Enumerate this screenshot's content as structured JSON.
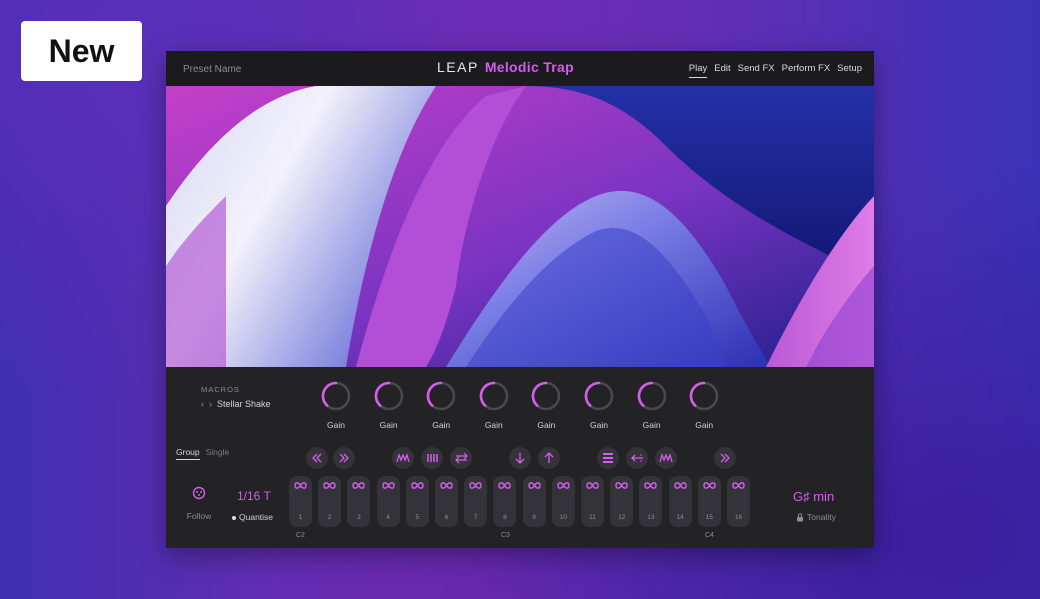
{
  "badge": {
    "label": "New"
  },
  "header": {
    "preset_name": "Preset Name",
    "logo_brand": "LEAP",
    "logo_product": "Melodic Trap",
    "nav": [
      "Play",
      "Edit",
      "Send FX",
      "Perform FX",
      "Setup"
    ],
    "active_tab": "Play"
  },
  "macros": {
    "section_label": "MACROS",
    "prev_icon": "chevron-left-icon",
    "next_icon": "chevron-right-icon",
    "current": "Stellar Shake",
    "knobs": [
      {
        "label": "Gain"
      },
      {
        "label": "Gain"
      },
      {
        "label": "Gain"
      },
      {
        "label": "Gain"
      },
      {
        "label": "Gain"
      },
      {
        "label": "Gain"
      },
      {
        "label": "Gain"
      },
      {
        "label": "Gain"
      }
    ]
  },
  "modes": {
    "group": "Group",
    "single": "Single"
  },
  "transport_icons": [
    "rewind-icon",
    "fast-forward-icon",
    "wave-icon",
    "bars-icon",
    "swap-icon",
    "arrow-down-icon",
    "arrow-up-icon",
    "list-icon",
    "arrow-back-icon",
    "wave-icon",
    "skip-icon"
  ],
  "follow": {
    "label": "Follow",
    "icon": "follow-icon"
  },
  "rate": {
    "value": "1/16 T",
    "quantise_label": "Quantise"
  },
  "pads": {
    "numbers": [
      "1",
      "2",
      "3",
      "4",
      "5",
      "6",
      "7",
      "8",
      "9",
      "10",
      "11",
      "12",
      "13",
      "14",
      "15",
      "16"
    ],
    "icon": "infinity-icon",
    "octaves": [
      "C2",
      "C3",
      "C4"
    ]
  },
  "key": {
    "value": "G♯ min",
    "tonality_label": "Tonality",
    "lock_icon": "lock-icon"
  },
  "colors": {
    "accent": "#d65cf0",
    "panel": "#232225",
    "topbar": "#1b1a1d",
    "button": "#35333a"
  }
}
